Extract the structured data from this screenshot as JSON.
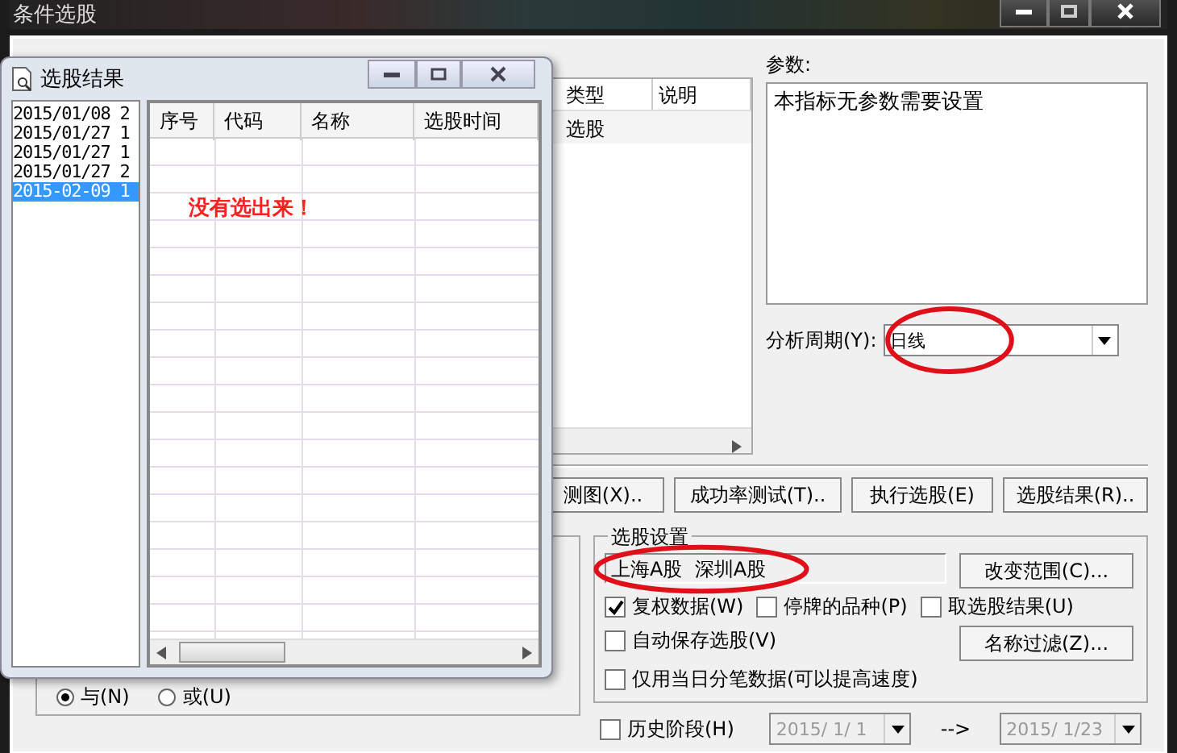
{
  "main_window": {
    "title": "条件选股",
    "formula_list": {
      "columns": [
        "类型",
        "说明"
      ],
      "rows": [
        [
          "选股",
          ""
        ]
      ]
    },
    "params": {
      "label": "参数:",
      "text": "本指标无参数需要设置"
    },
    "period": {
      "label": "分析周期(Y):",
      "value": "日线",
      "highlighted": true
    },
    "buttons": [
      "测图(X)..",
      "成功率测试(T)..",
      "执行选股(E)",
      "选股结果(R).."
    ],
    "logic": [
      {
        "label": "与(N)",
        "selected": true
      },
      {
        "label": "或(U)",
        "selected": false
      }
    ],
    "settings": {
      "title": "选股设置",
      "range": "上海A股  深圳A股",
      "range_highlighted": true,
      "range_button": "改变范围(C)...",
      "filter_button": "名称过滤(Z)...",
      "checks": [
        {
          "label": "复权数据(W)",
          "checked": true
        },
        {
          "label": "停牌的品种(P)",
          "checked": false
        },
        {
          "label": "取选股结果(U)",
          "checked": false
        },
        {
          "label": "自动保存选股(V)",
          "checked": false
        },
        {
          "label": "仅用当日分笔数据(可以提高速度)",
          "checked": false
        }
      ]
    },
    "history": {
      "label": "历史阶段(H)",
      "checked": false,
      "from": "2015/ 1/ 1",
      "arrow": "-->",
      "to": "2015/ 1/23",
      "disabled": true
    }
  },
  "result_window": {
    "title": "选股结果",
    "runs": [
      {
        "label": "2015/01/08 2",
        "selected": false
      },
      {
        "label": "2015/01/27 1",
        "selected": false
      },
      {
        "label": "2015/01/27 1",
        "selected": false
      },
      {
        "label": "2015/01/27 2",
        "selected": false
      },
      {
        "label": "2015-02-09 1",
        "selected": true
      }
    ],
    "columns": [
      "序号",
      "代码",
      "名称",
      "选股时间"
    ],
    "message": "没有选出来！"
  }
}
